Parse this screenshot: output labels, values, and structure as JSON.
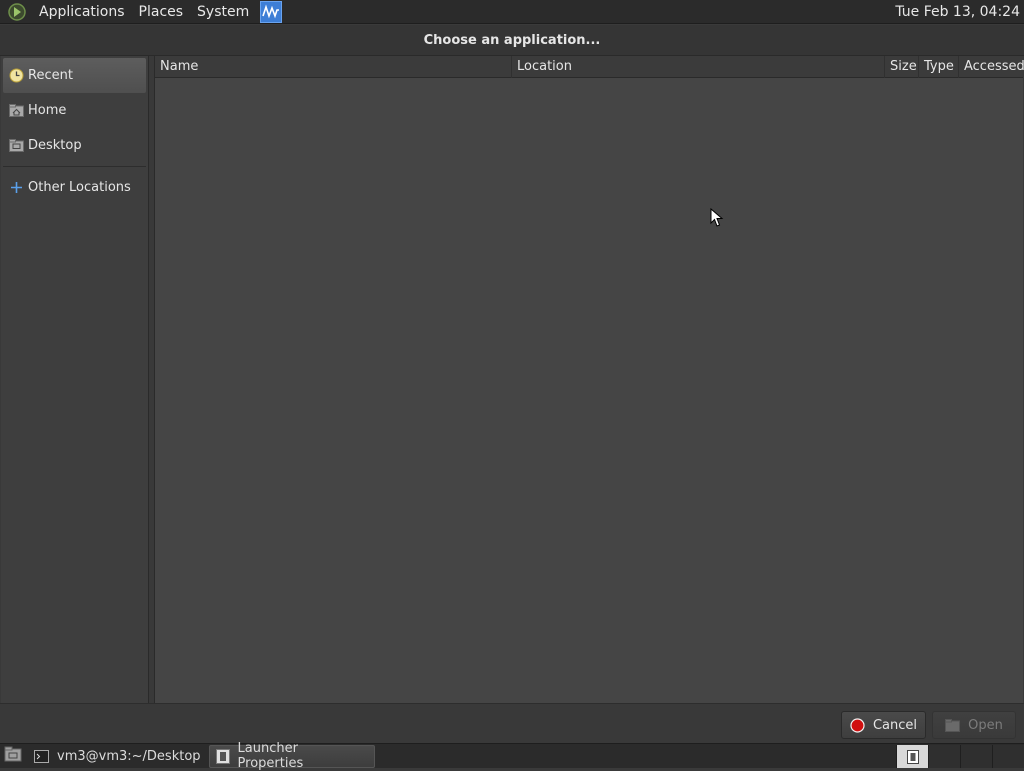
{
  "top_panel": {
    "menus": [
      "Applications",
      "Places",
      "System"
    ],
    "clock": "Tue Feb 13, 04:24"
  },
  "dialog": {
    "title": "Choose an application...",
    "sidebar": {
      "items": [
        {
          "label": "Recent",
          "icon": "recent-icon",
          "selected": true
        },
        {
          "label": "Home",
          "icon": "home-folder-icon",
          "selected": false
        },
        {
          "label": "Desktop",
          "icon": "desktop-folder-icon",
          "selected": false
        }
      ],
      "other": {
        "label": "Other Locations",
        "icon": "plus-icon"
      }
    },
    "columns": [
      "Name",
      "Location",
      "Size",
      "Type",
      "Accessed"
    ],
    "buttons": {
      "cancel": "Cancel",
      "open": "Open"
    }
  },
  "bottom_panel": {
    "tasks": [
      {
        "label": "vm3@vm3:~/Desktop",
        "icon": "terminal-icon"
      },
      {
        "label": "Launcher Properties",
        "icon": "launcher-icon"
      }
    ]
  },
  "colors": {
    "accent": "#3d7ed6",
    "cancel_red": "#d01010"
  }
}
